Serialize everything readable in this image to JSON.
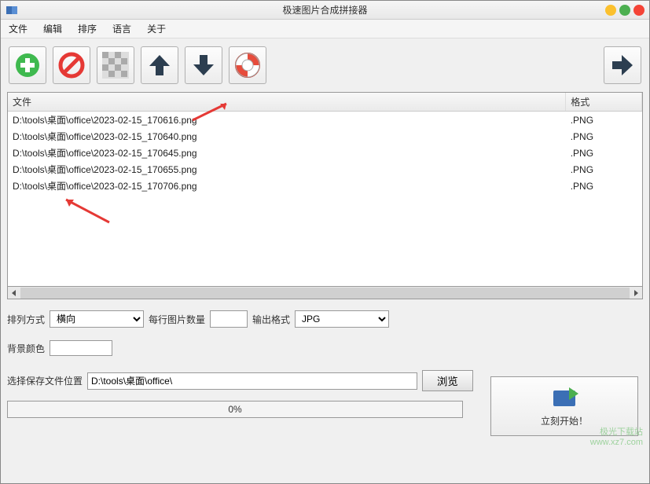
{
  "window": {
    "title": "极速图片合成拼接器"
  },
  "menu": {
    "file": "文件",
    "edit": "编辑",
    "sort": "排序",
    "language": "语言",
    "about": "关于"
  },
  "table": {
    "col_file": "文件",
    "col_format": "格式",
    "rows": [
      {
        "file": "D:\\tools\\桌面\\office\\2023-02-15_170616.png",
        "fmt": ".PNG"
      },
      {
        "file": "D:\\tools\\桌面\\office\\2023-02-15_170640.png",
        "fmt": ".PNG"
      },
      {
        "file": "D:\\tools\\桌面\\office\\2023-02-15_170645.png",
        "fmt": ".PNG"
      },
      {
        "file": "D:\\tools\\桌面\\office\\2023-02-15_170655.png",
        "fmt": ".PNG"
      },
      {
        "file": "D:\\tools\\桌面\\office\\2023-02-15_170706.png",
        "fmt": ".PNG"
      }
    ]
  },
  "settings": {
    "arrange_label": "排列方式",
    "arrange_value": "横向",
    "per_row_label": "每行图片数量",
    "per_row_value": "",
    "output_label": "输出格式",
    "output_value": "JPG",
    "bg_label": "背景颜色",
    "save_label": "选择保存文件位置",
    "save_path": "D:\\tools\\桌面\\office\\",
    "browse": "浏览",
    "progress": "0%",
    "start": "立刻开始！"
  },
  "watermark": {
    "line1": "极光下载站",
    "line2": "www.xz7.com"
  }
}
